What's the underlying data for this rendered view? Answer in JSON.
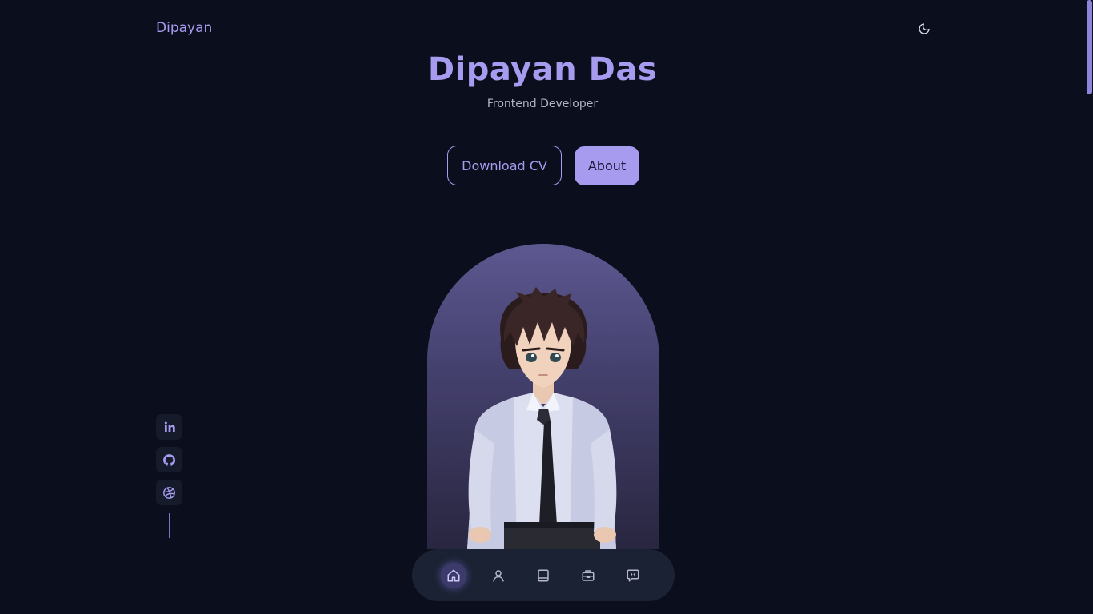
{
  "header": {
    "logo": "Dipayan",
    "theme_icon": "moon-icon"
  },
  "hero": {
    "name": "Dipayan Das",
    "role": "Frontend Developer",
    "download_cv_label": "Download CV",
    "about_label": "About"
  },
  "social": {
    "items": [
      {
        "name": "linkedin",
        "icon": "linkedin-icon"
      },
      {
        "name": "github",
        "icon": "github-icon"
      },
      {
        "name": "dribbble",
        "icon": "dribbble-icon"
      }
    ]
  },
  "bottom_nav": {
    "items": [
      {
        "name": "home",
        "icon": "home-icon",
        "active": true
      },
      {
        "name": "about",
        "icon": "user-icon",
        "active": false
      },
      {
        "name": "resume",
        "icon": "book-icon",
        "active": false
      },
      {
        "name": "portfolio",
        "icon": "briefcase-icon",
        "active": false
      },
      {
        "name": "contact",
        "icon": "chat-icon",
        "active": false
      }
    ]
  },
  "colors": {
    "accent": "#a79bf0",
    "background": "#0b0f1d",
    "nav_background": "#1b2233"
  }
}
